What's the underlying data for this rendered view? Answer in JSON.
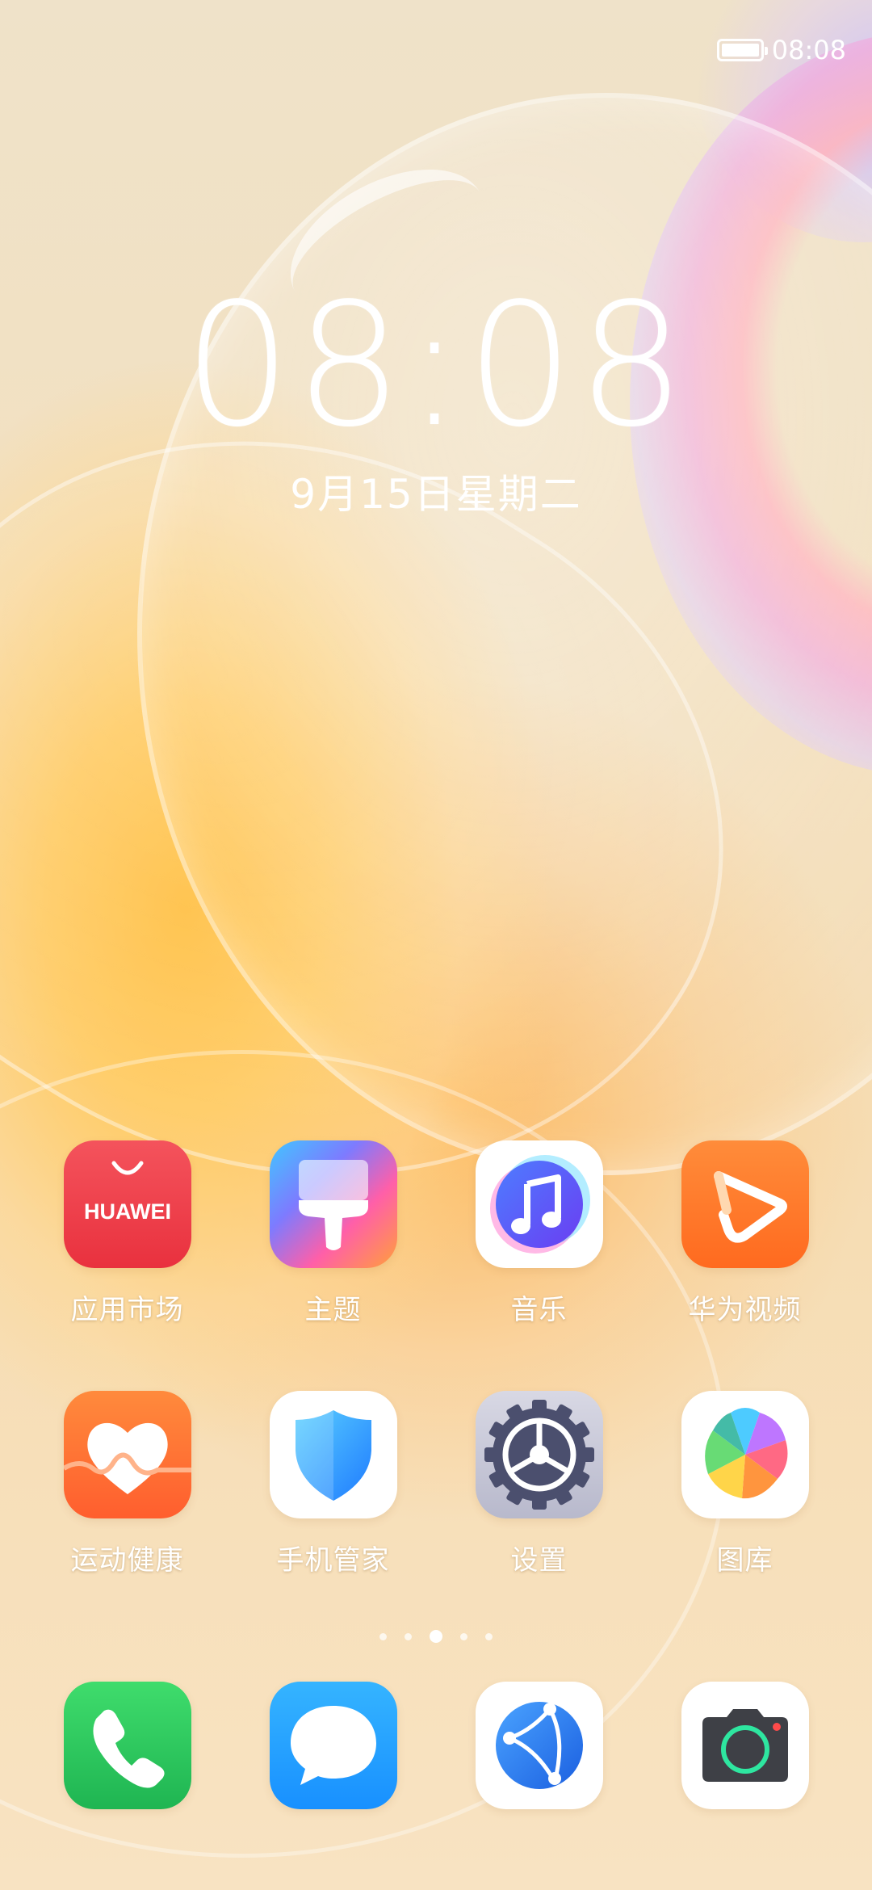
{
  "status_bar": {
    "time": "08:08",
    "battery_level": 1.0
  },
  "lock_clock": {
    "time": "08:08",
    "date": "9月15日星期二"
  },
  "apps_row1": [
    {
      "label": "应用市场",
      "icon": "appgallery-icon",
      "icon_text": "HUAWEI"
    },
    {
      "label": "主题",
      "icon": "themes-brush-icon"
    },
    {
      "label": "音乐",
      "icon": "music-note-icon"
    },
    {
      "label": "华为视频",
      "icon": "video-play-icon"
    }
  ],
  "apps_row2": [
    {
      "label": "运动健康",
      "icon": "health-heart-icon"
    },
    {
      "label": "手机管家",
      "icon": "shield-icon"
    },
    {
      "label": "设置",
      "icon": "gear-icon"
    },
    {
      "label": "图库",
      "icon": "gallery-pinwheel-icon"
    }
  ],
  "page_indicator": {
    "pages": 5,
    "current": 3
  },
  "dock": [
    {
      "name": "phone",
      "icon": "phone-icon"
    },
    {
      "name": "messages",
      "icon": "message-bubble-icon"
    },
    {
      "name": "browser",
      "icon": "browser-globe-icon"
    },
    {
      "name": "camera",
      "icon": "camera-icon"
    }
  ],
  "colors": {
    "appgallery": "#ef3c48",
    "video": "#ff7a2a",
    "health": "#ff6d34",
    "phone": "#26c15a",
    "messages": "#1e9bff",
    "text": "#ffffff"
  }
}
